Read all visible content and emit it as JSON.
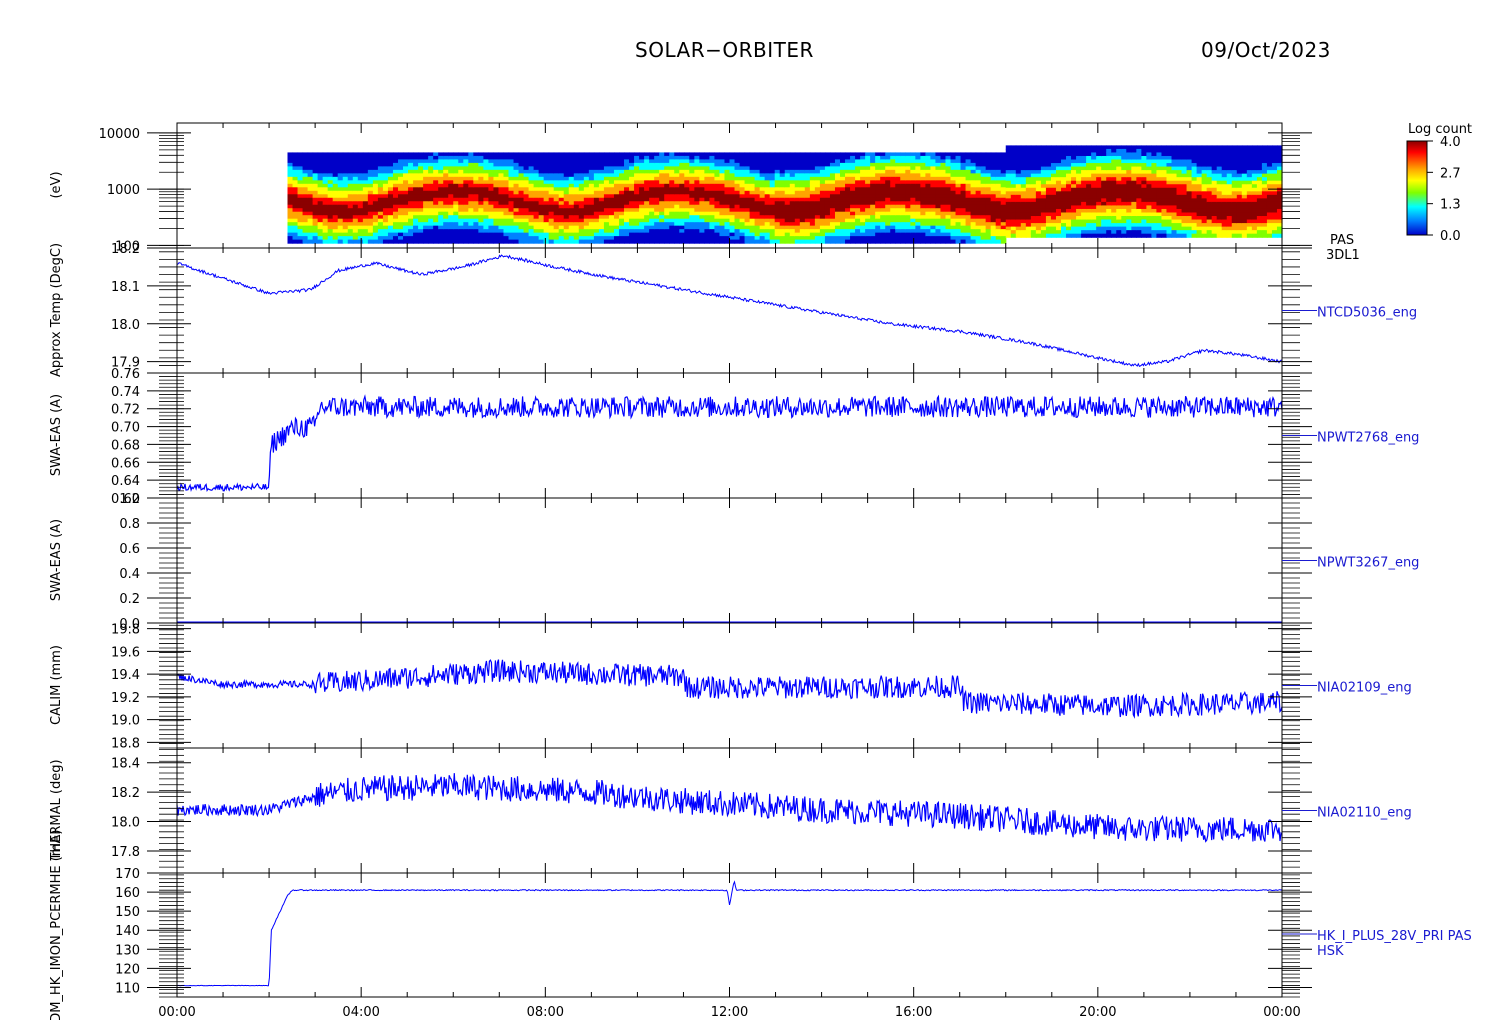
{
  "header": {
    "mission": "SOLAR−ORBITER",
    "date": "09/Oct/2023"
  },
  "colorbar": {
    "label": "Log count",
    "ticks": [
      "4.0",
      "2.7",
      "1.3",
      "0.0"
    ],
    "colors": [
      "#8b0000",
      "#ff0000",
      "#ffa500",
      "#ffff00",
      "#7fff00",
      "#00ffff",
      "#0080ff",
      "#0000c8"
    ]
  },
  "colors": {
    "series": "#0000ff",
    "label": "#1a1ad0",
    "axis": "#000000"
  },
  "chart_data": {
    "type": "line",
    "x_ticks": [
      "00:00",
      "04:00",
      "08:00",
      "12:00",
      "16:00",
      "20:00",
      "00:00"
    ],
    "x_range_hours": [
      0,
      24
    ],
    "panels": [
      {
        "type": "heatmap",
        "series_label": [
          "PAS",
          "3DL1"
        ],
        "ylabel": "(eV)",
        "y_scale": "log",
        "ylim": [
          90,
          15000
        ],
        "y_ticks": [
          "10000",
          "1000",
          "100"
        ],
        "data_start_hour": 2.4,
        "peak_energy_ev": 650,
        "energy_range_start_ev": [
          110,
          4500
        ],
        "energy_range_after_18h_ev": [
          140,
          6000
        ]
      },
      {
        "type": "line",
        "series_label": [
          "NTCD5036_eng"
        ],
        "ylabel": "Approx Temp (DegC)",
        "ylim": [
          17.87,
          18.2
        ],
        "y_ticks": [
          "18.2",
          "18.1",
          "18.0",
          "17.9"
        ],
        "x": [
          0,
          1,
          2,
          2.9,
          3.5,
          4.3,
          5.3,
          6.2,
          7.1,
          8.2,
          9.5,
          11,
          12.5,
          14,
          15.5,
          17,
          18.5,
          20,
          20.8,
          21.5,
          22.3,
          23,
          24
        ],
        "values": [
          18.16,
          18.12,
          18.08,
          18.09,
          18.14,
          18.16,
          18.13,
          18.15,
          18.18,
          18.15,
          18.12,
          18.09,
          18.06,
          18.03,
          18.0,
          17.98,
          17.95,
          17.91,
          17.89,
          17.9,
          17.93,
          17.92,
          17.9
        ]
      },
      {
        "type": "line",
        "series_label": [
          "NPWT2768_eng"
        ],
        "ylabel": "SWA-EAS (A)",
        "ylim": [
          0.62,
          0.76
        ],
        "y_ticks": [
          "0.76",
          "0.74",
          "0.72",
          "0.70",
          "0.68",
          "0.66",
          "0.64",
          "0.62"
        ],
        "x": [
          0,
          2.0,
          2.05,
          2.5,
          3.0,
          3.1,
          24
        ],
        "values": [
          0.632,
          0.632,
          0.68,
          0.698,
          0.7,
          0.722,
          0.722
        ]
      },
      {
        "type": "line",
        "series_label": [
          "NPWT3267_eng"
        ],
        "ylabel": "SWA-EAS (A)",
        "ylim": [
          0.0,
          1.0
        ],
        "y_ticks": [
          "1.0",
          "0.8",
          "0.6",
          "0.4",
          "0.2",
          "0.0"
        ],
        "x": [
          0,
          24
        ],
        "values": [
          0.0,
          0.0
        ]
      },
      {
        "type": "line",
        "series_label": [
          "NIA02109_eng"
        ],
        "ylabel": "CALIM (mm)",
        "ylim": [
          18.75,
          19.85
        ],
        "y_ticks": [
          "19.8",
          "19.6",
          "19.4",
          "19.2",
          "19.0",
          "18.8"
        ],
        "x": [
          0,
          1.0,
          3.0,
          5.0,
          7.0,
          9.0,
          11.0,
          11.1,
          17.0,
          17.1,
          20.5,
          24
        ],
        "values": [
          19.38,
          19.31,
          19.31,
          19.37,
          19.43,
          19.4,
          19.38,
          19.28,
          19.29,
          19.15,
          19.12,
          19.15
        ]
      },
      {
        "type": "line",
        "series_label": [
          "NIA02110_eng"
        ],
        "ylabel": "THERMAL (deg)",
        "ylim": [
          17.65,
          18.5
        ],
        "y_ticks": [
          "18.4",
          "18.2",
          "18.0",
          "17.8"
        ],
        "x": [
          0,
          2.0,
          3.1,
          4.0,
          6.0,
          9.0,
          11.0,
          14.0,
          17.0,
          20.5,
          24
        ],
        "values": [
          18.08,
          18.08,
          18.18,
          18.22,
          18.24,
          18.2,
          18.14,
          18.08,
          18.04,
          17.95,
          17.95
        ]
      },
      {
        "type": "line",
        "series_label": [
          "HK_I_PLUS_28V_PRI PAS",
          "HSK"
        ],
        "ylabel": "PHDM_HK_IMON_PCERMHE (mA)",
        "ylim": [
          105,
          170
        ],
        "y_ticks": [
          "170",
          "160",
          "150",
          "140",
          "130",
          "120",
          "110"
        ],
        "x": [
          0,
          2.0,
          2.05,
          2.2,
          2.4,
          2.5,
          11.95,
          12.0,
          12.1,
          12.15,
          24
        ],
        "values": [
          111,
          111,
          140,
          148,
          158,
          161,
          161,
          153,
          166,
          161,
          161
        ]
      }
    ]
  }
}
